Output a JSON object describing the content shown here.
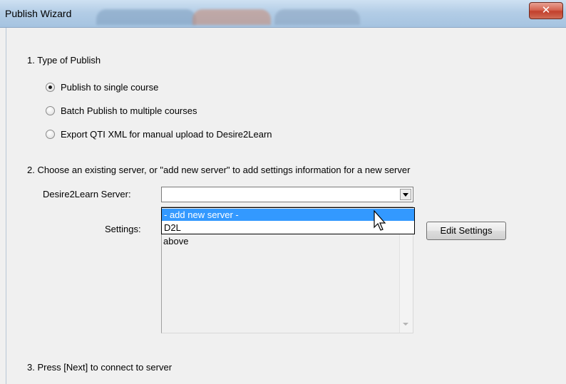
{
  "window": {
    "title": "Publish Wizard",
    "close_glyph": "✕"
  },
  "section1": {
    "heading": "1.  Type of Publish",
    "options": [
      {
        "label": "Publish to single course",
        "selected": true
      },
      {
        "label": "Batch Publish to multiple courses",
        "selected": false
      },
      {
        "label": "Export QTI XML for manual upload to Desire2Learn",
        "selected": false
      }
    ]
  },
  "section2": {
    "heading": "2.  Choose an existing server, or \"add new server\" to add settings information for a new server",
    "server_label": "Desire2Learn Server:",
    "server_value": "",
    "settings_label": "Settings:",
    "dropdown_options": [
      "- add new server -",
      "D2L"
    ],
    "dropdown_highlighted": "- add new server -",
    "settings_text": "above",
    "edit_button": "Edit Settings"
  },
  "section3": {
    "heading": "3.  Press [Next] to connect to server"
  },
  "colors": {
    "selection": "#3399ff",
    "close_button": "#c2402c"
  }
}
